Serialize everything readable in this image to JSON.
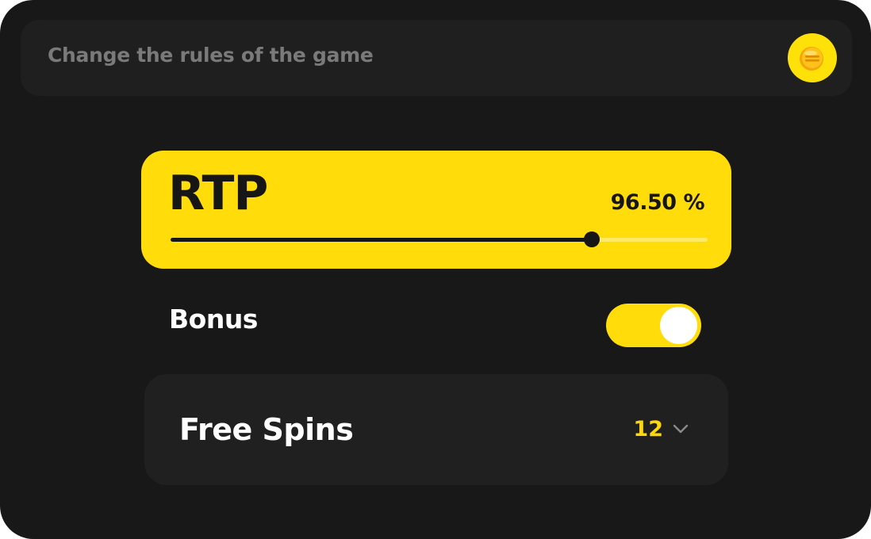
{
  "header": {
    "title": "Change the rules of the game",
    "coin_icon": "gold-coin-icon"
  },
  "rtp": {
    "label": "RTP",
    "value_text": "96.50 %",
    "slider_fraction": 0.785
  },
  "bonus": {
    "label": "Bonus",
    "enabled": true
  },
  "free_spins": {
    "label": "Free Spins",
    "selected": "12",
    "dropdown_icon": "chevron-down-icon"
  },
  "colors": {
    "background": "#181818",
    "card": "#1f1f1f",
    "accent": "#ffdc0a",
    "text": "#ffffff",
    "muted": "#7a7a7a"
  }
}
